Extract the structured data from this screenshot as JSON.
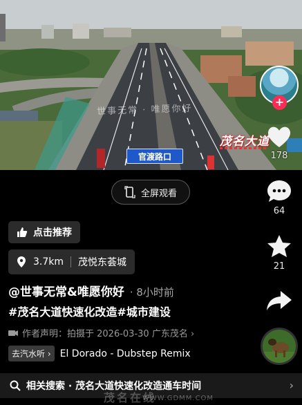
{
  "video": {
    "road_sign": "官渡路口",
    "brand_stamp": "茂名大道",
    "watermark_top": "世事无常 · 唯愿你好"
  },
  "actions": {
    "likes": "178",
    "comments": "64",
    "favorites": "21"
  },
  "fullscreen_label": "全屏观看",
  "recommend_label": "点击推荐",
  "location": {
    "distance": "3.7km",
    "name": "茂悦东荟城"
  },
  "author": {
    "name": "@世事无常&唯愿你好",
    "time": "· 8小时前"
  },
  "hashtags": "#茂名大道快速化改造#城市建设",
  "declaration": "作者声明：拍摄于 2026-03-30 广东茂名 ›",
  "music": {
    "tag": "去汽水听 ›",
    "song": "El Dorado - Dubstep Remix"
  },
  "search": {
    "label": "相关搜索 · 茂名大道快速化改造通车时间"
  },
  "site_watermark": {
    "name": "茂名在线",
    "url": "WWW.GDMM.COM"
  },
  "colors": {
    "accent": "#fe2c55",
    "sign_blue": "#1e58c9",
    "background": "#000000"
  }
}
